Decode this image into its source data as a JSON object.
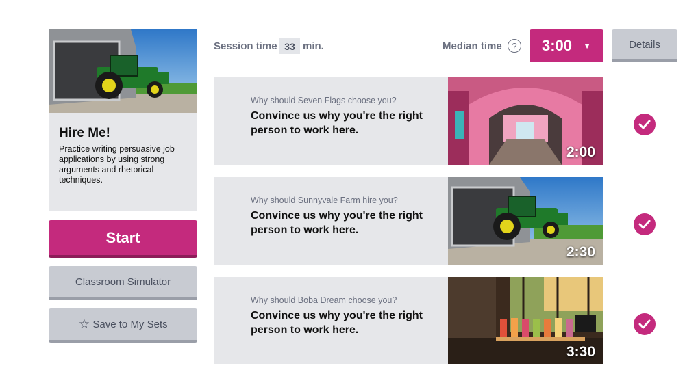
{
  "activity": {
    "title": "Hire Me!",
    "description": "Practice writing persuasive job applications by using strong arguments and rhetorical techniques.",
    "image": "tractor-barn-photo"
  },
  "buttons": {
    "start": "Start",
    "classroom_simulator": "Classroom Simulator",
    "save": "Save to My Sets",
    "details": "Details"
  },
  "session": {
    "label": "Session time",
    "value": "33",
    "unit": "min."
  },
  "median": {
    "label": "Median time",
    "value": "3:00",
    "help_icon": "question-circle-icon",
    "caret": "▼"
  },
  "prompts": [
    {
      "question": "Why should Seven Flags choose you?",
      "prompt": "Convince us why you're the right person to work here.",
      "time": "2:00",
      "image": "amusement-park-arcade-photo",
      "completed": true
    },
    {
      "question": "Why should Sunnyvale Farm hire you?",
      "prompt": "Convince us why you're the right person to work here.",
      "time": "2:30",
      "image": "tractor-barn-photo",
      "completed": true
    },
    {
      "question": "Why should Boba Dream choose you?",
      "prompt": "Convince us why you're the right person to work here.",
      "time": "3:30",
      "image": "boba-cafe-photo",
      "completed": true
    }
  ],
  "colors": {
    "accent": "#c42a7d",
    "panel": "#e6e7ea",
    "grey_button": "#c8cbd2",
    "muted_text": "#6b7080"
  }
}
